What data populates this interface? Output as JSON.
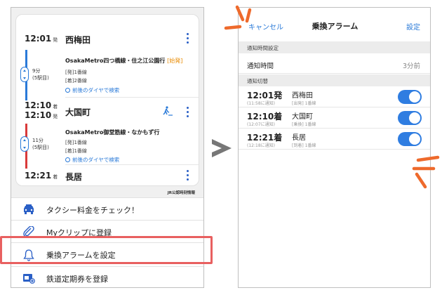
{
  "left": {
    "stops": [
      {
        "time": "12:01",
        "mark": "発",
        "station": "西梅田"
      },
      {
        "time": "12:10",
        "mark": "着",
        "station": "大国町",
        "time2": "12:10",
        "mark2": "発"
      },
      {
        "time": "12:21",
        "mark": "着",
        "station": "長居"
      }
    ],
    "segments": [
      {
        "duration": "9分",
        "stations": "(5駅目)",
        "line": "OsakaMetro四つ橋線・住之江公園行",
        "tag": "[始発]",
        "dep_platform": "[発]1番線",
        "arr_platform": "[着]2番線",
        "link": "前後のダイヤで検索",
        "color": "#2a7ad8"
      },
      {
        "duration": "11分",
        "stations": "(5駅目)",
        "line": "OsakaMetro御堂筋線・なかもず行",
        "tag": "",
        "dep_platform": "[発]1番線",
        "arr_platform": "[着]1番線",
        "link": "前後のダイヤで検索",
        "color": "#d93a3a"
      }
    ],
    "credit": "JR公認時刻情報",
    "actions": [
      {
        "label": "タクシー料金をチェック！",
        "icon": "taxi-icon"
      },
      {
        "label": "Myクリップに登録",
        "icon": "clip-icon"
      },
      {
        "label": "乗換アラームを設定",
        "icon": "bell-icon"
      },
      {
        "label": "鉄道定期券を登録",
        "icon": "pass-card-icon"
      }
    ],
    "highlight_color": "#e86060"
  },
  "right": {
    "nav": {
      "cancel": "キャンセル",
      "title": "乗換アラーム",
      "set": "設定"
    },
    "section_time": "通知時間設定",
    "notify_label": "通知時間",
    "notify_value": "3分前",
    "section_switch": "通知切替",
    "rows": [
      {
        "time": "12:01発",
        "sub": "(11:58に通知)",
        "station": "西梅田",
        "platform": "[出発] 1番線",
        "on": true
      },
      {
        "time": "12:10着",
        "sub": "(12:07に通知)",
        "station": "大国町",
        "platform": "[乗換] 1番線",
        "on": true
      },
      {
        "time": "12:21着",
        "sub": "(12:18に通知)",
        "station": "長居",
        "platform": "[到着] 1番線",
        "on": true
      }
    ],
    "accent": "#2f7de1"
  },
  "decor": {
    "burst_color": "#ee6a2c",
    "arrow_color": "#777777"
  }
}
